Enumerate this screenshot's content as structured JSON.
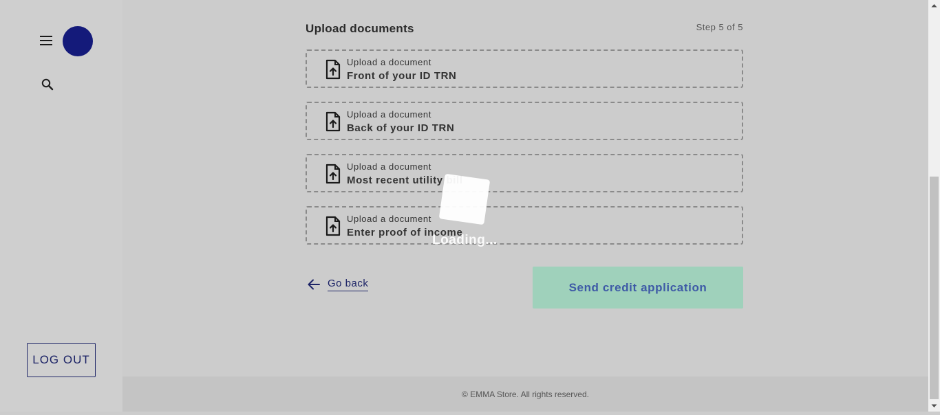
{
  "sidebar": {
    "menu_icon": "hamburger-menu-icon",
    "search_icon": "search-icon",
    "logout_label": "LOG OUT",
    "avatar_color": "#141a7a"
  },
  "main": {
    "title": "Upload documents",
    "step": "Step 5 of 5",
    "uploads": [
      {
        "label": "Upload a document",
        "name": "Front of your ID TRN",
        "icon": "upload-file-icon"
      },
      {
        "label": "Upload a document",
        "name": "Back of your ID TRN",
        "icon": "upload-file-icon"
      },
      {
        "label": "Upload a document",
        "name": "Most recent utility bill",
        "icon": "upload-file-icon"
      },
      {
        "label": "Upload a document",
        "name": "Enter proof of income",
        "icon": "upload-file-icon"
      }
    ],
    "go_back_label": "Go back",
    "send_label": "Send credit application"
  },
  "loading": {
    "text": "Loading..."
  },
  "footer": {
    "text": "© EMMA Store. All rights reserved."
  },
  "colors": {
    "brand_navy": "#1c2366",
    "send_button_bg": "#9fd1bb",
    "send_button_text": "#3e5aa6",
    "page_bg": "#cccccc"
  }
}
